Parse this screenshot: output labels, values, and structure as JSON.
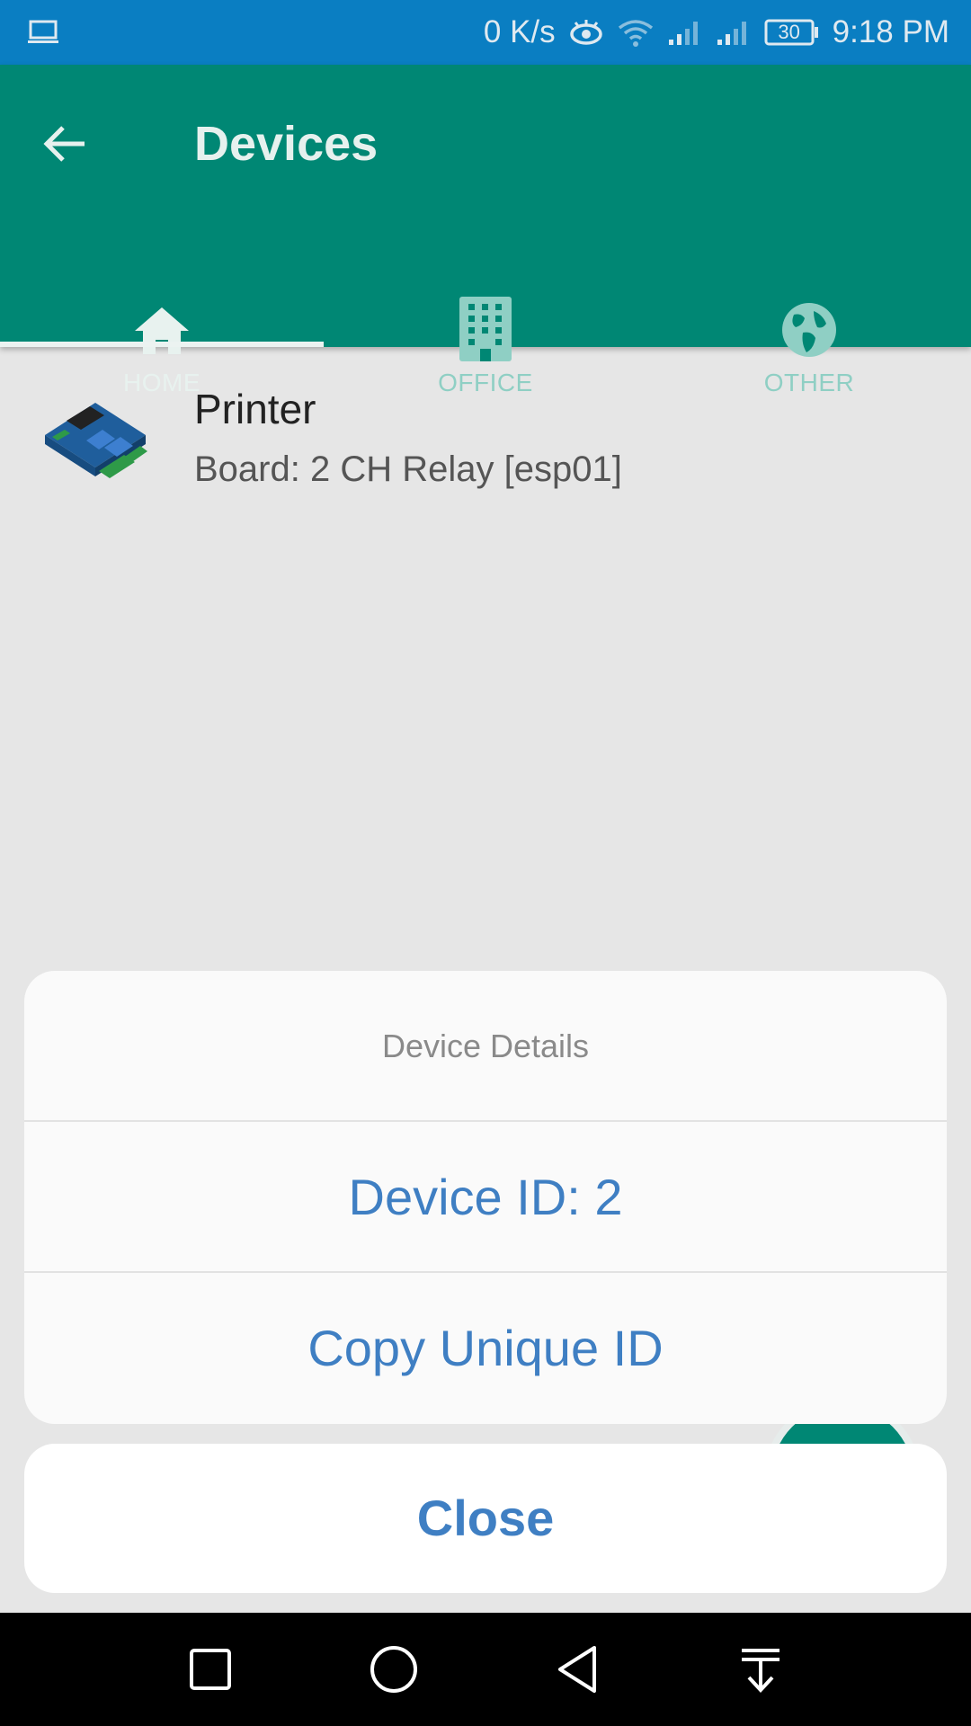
{
  "status_bar": {
    "net_speed": "0 K/s",
    "battery": "30",
    "time": "9:18 PM"
  },
  "app_bar": {
    "title": "Devices",
    "colors": {
      "primary": "#008774",
      "status": "#0a7ec2"
    }
  },
  "tabs": [
    {
      "label": "HOME",
      "icon": "home-icon",
      "selected": true
    },
    {
      "label": "OFFICE",
      "icon": "building-icon",
      "selected": false
    },
    {
      "label": "OTHER",
      "icon": "globe-icon",
      "selected": false
    }
  ],
  "devices": [
    {
      "name": "Printer",
      "board": "Board: 2 CH Relay [esp01]",
      "icon": "relay-board-image"
    }
  ],
  "sheet": {
    "title": "Device Details",
    "device_id": "Device ID: 2",
    "copy_unique_id": "Copy Unique ID",
    "close": "Close",
    "accent": "#3f7fc3"
  },
  "nav": {
    "icons": [
      "recents-icon",
      "home-circle-icon",
      "back-triangle-icon",
      "notification-pull-icon"
    ]
  }
}
